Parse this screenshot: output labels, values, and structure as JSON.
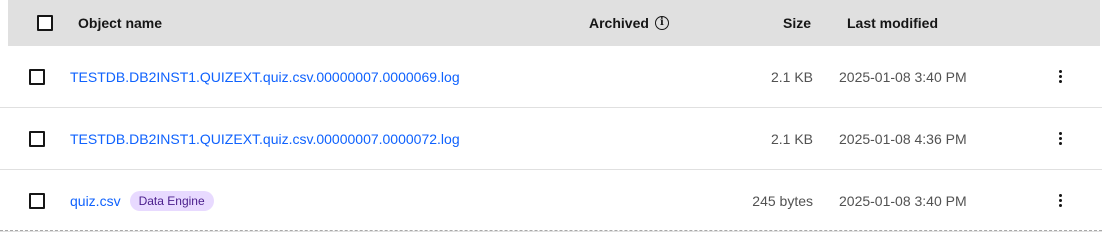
{
  "table": {
    "headers": {
      "name": "Object name",
      "archived": "Archived",
      "size": "Size",
      "last_modified": "Last modified"
    },
    "rows": [
      {
        "name": "TESTDB.DB2INST1.QUIZEXT.quiz.csv.00000007.0000069.log",
        "tag": "",
        "size": "2.1 KB",
        "last_modified": "2025-01-08 3:40 PM"
      },
      {
        "name": "TESTDB.DB2INST1.QUIZEXT.quiz.csv.00000007.0000072.log",
        "tag": "",
        "size": "2.1 KB",
        "last_modified": "2025-01-08 4:36 PM"
      },
      {
        "name": "quiz.csv",
        "tag": "Data Engine",
        "size": "245 bytes",
        "last_modified": "2025-01-08 3:40 PM"
      }
    ]
  },
  "icons": {
    "archived_info": "info-icon",
    "row_menu": "overflow-menu-icon"
  },
  "colors": {
    "link": "#0f62fe",
    "header_bg": "#e0e0e0",
    "tag_bg": "#e8daff",
    "tag_text": "#491d8b"
  }
}
